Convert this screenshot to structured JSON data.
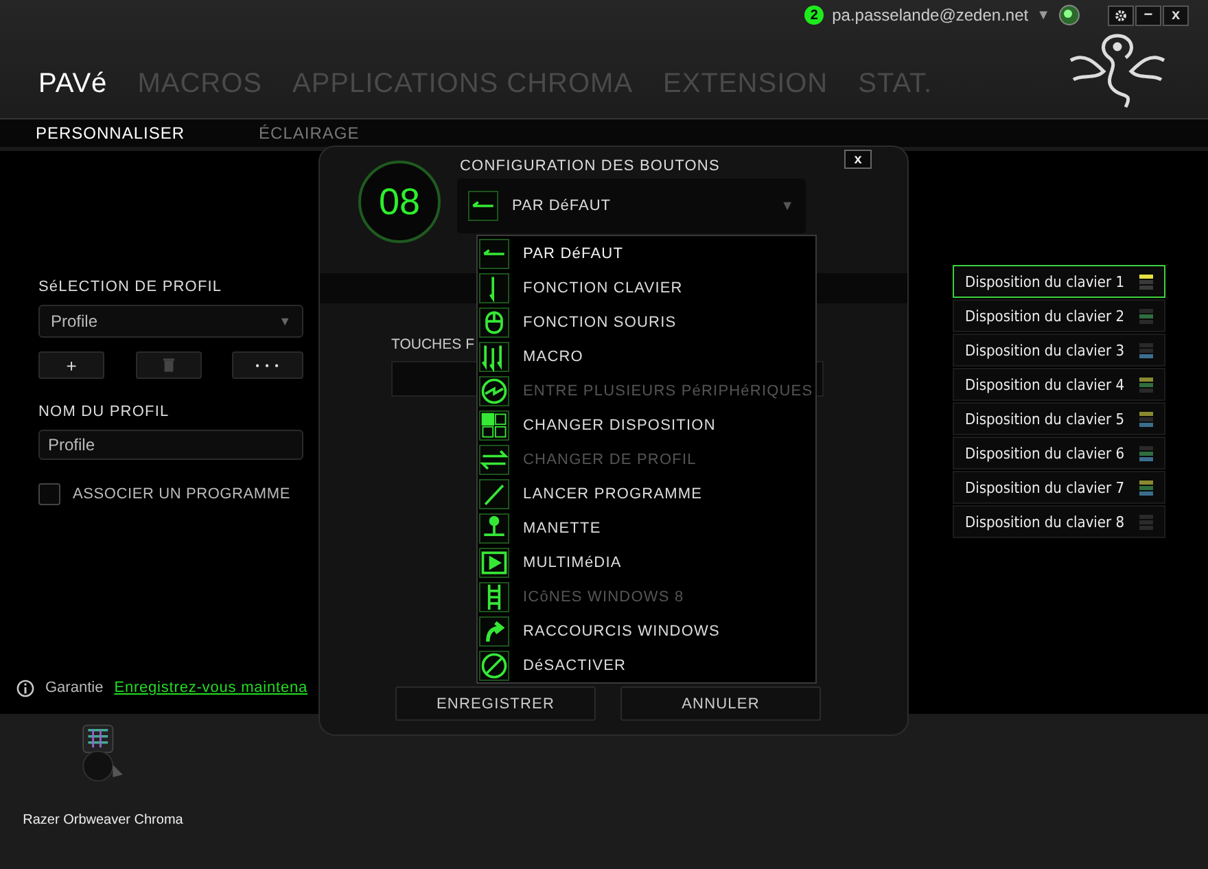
{
  "account": {
    "notifications": "2",
    "email": "pa.passelande@zeden.net",
    "caret": "▼"
  },
  "window_controls": [
    "−",
    "x"
  ],
  "tabs": [
    {
      "label": "PAVé",
      "selected": true
    },
    {
      "label": "MACROS",
      "selected": false
    },
    {
      "label": "APPLICATIONS CHROMA",
      "selected": false
    },
    {
      "label": "EXTENSION",
      "selected": false
    },
    {
      "label": "STAT.",
      "selected": false
    }
  ],
  "subtabs": [
    {
      "label": "PERSONNALISER",
      "selected": true
    },
    {
      "label": "ÉCLAIRAGE",
      "selected": false
    }
  ],
  "profile": {
    "heading": "SéLECTION DE PROFIL",
    "value": "Profile",
    "caret": "▼",
    "add": "+",
    "more": "• • •",
    "name_label": "NOM DU PROFIL",
    "name_value": "Profile",
    "link_program": {
      "label": "ASSOCIER UN PROGRAMME",
      "checked": false
    }
  },
  "layouts": [
    {
      "label": "Disposition du clavier 1",
      "selected": true,
      "stripes": [
        {
          "color": "#e6e040"
        },
        {
          "color": "#3a3a3a"
        },
        {
          "color": "#3a3a3a"
        }
      ]
    },
    {
      "label": "Disposition du clavier 2",
      "selected": false,
      "stripes": [
        {
          "color": "#2a2a2a"
        },
        {
          "color": "#2f6e3e"
        },
        {
          "color": "#2a2a2a"
        }
      ]
    },
    {
      "label": "Disposition du clavier 3",
      "selected": false,
      "stripes": [
        {
          "color": "#2a2a2a"
        },
        {
          "color": "#2a2a2a"
        },
        {
          "color": "#3a6e8e"
        }
      ]
    },
    {
      "label": "Disposition du clavier 4",
      "selected": false,
      "stripes": [
        {
          "color": "#8a8a30"
        },
        {
          "color": "#2f6e3e"
        },
        {
          "color": "#2a2a2a"
        }
      ]
    },
    {
      "label": "Disposition du clavier 5",
      "selected": false,
      "stripes": [
        {
          "color": "#8a8a30"
        },
        {
          "color": "#2a2a2a"
        },
        {
          "color": "#3a6e8e"
        }
      ]
    },
    {
      "label": "Disposition du clavier 6",
      "selected": false,
      "stripes": [
        {
          "color": "#2a2a2a"
        },
        {
          "color": "#2f6e3e"
        },
        {
          "color": "#3a6e8e"
        }
      ]
    },
    {
      "label": "Disposition du clavier 7",
      "selected": false,
      "stripes": [
        {
          "color": "#8a8a30"
        },
        {
          "color": "#2f6e3e"
        },
        {
          "color": "#3a6e8e"
        }
      ]
    },
    {
      "label": "Disposition du clavier 8",
      "selected": false,
      "stripes": [
        {
          "color": "#2a2a2a"
        },
        {
          "color": "#2a2a2a"
        },
        {
          "color": "#2a2a2a"
        }
      ]
    }
  ],
  "warranty": {
    "label": "Garantie",
    "link": "Enregistrez-vous maintena"
  },
  "device": {
    "name": "Razer Orbweaver Chroma"
  },
  "dialog": {
    "close": "x",
    "key_number": "08",
    "title": "CONFIGURATION DES BOUTONS",
    "selected_label": "PAR DéFAUT",
    "caret": "▼",
    "behind_label": "TOUCHES F",
    "options": [
      {
        "kind": "default",
        "label": "PAR DéFAUT",
        "disabled": false,
        "selected": true
      },
      {
        "kind": "keyboard",
        "label": "FONCTION CLAVIER",
        "disabled": false,
        "selected": false
      },
      {
        "kind": "mouse",
        "label": "FONCTION SOURIS",
        "disabled": false,
        "selected": false
      },
      {
        "kind": "macro",
        "label": "MACRO",
        "disabled": false,
        "selected": false
      },
      {
        "kind": "interdevice",
        "label": "ENTRE PLUSIEURS PéRIPHéRIQUES",
        "disabled": true,
        "selected": false
      },
      {
        "kind": "layout",
        "label": "CHANGER DISPOSITION",
        "disabled": false,
        "selected": false
      },
      {
        "kind": "profile",
        "label": "CHANGER DE PROFIL",
        "disabled": true,
        "selected": false
      },
      {
        "kind": "launch",
        "label": "LANCER PROGRAMME",
        "disabled": false,
        "selected": false
      },
      {
        "kind": "gamepad",
        "label": "MANETTE",
        "disabled": false,
        "selected": false
      },
      {
        "kind": "multimedia",
        "label": "MULTIMéDIA",
        "disabled": false,
        "selected": false
      },
      {
        "kind": "windows8",
        "label": "ICôNES WINDOWS 8",
        "disabled": true,
        "selected": false
      },
      {
        "kind": "shortcut",
        "label": "RACCOURCIS WINDOWS",
        "disabled": false,
        "selected": false
      },
      {
        "kind": "disable",
        "label": "DéSACTIVER",
        "disabled": false,
        "selected": false
      }
    ],
    "buttons": [
      "ENREGISTRER",
      "ANNULER"
    ]
  }
}
